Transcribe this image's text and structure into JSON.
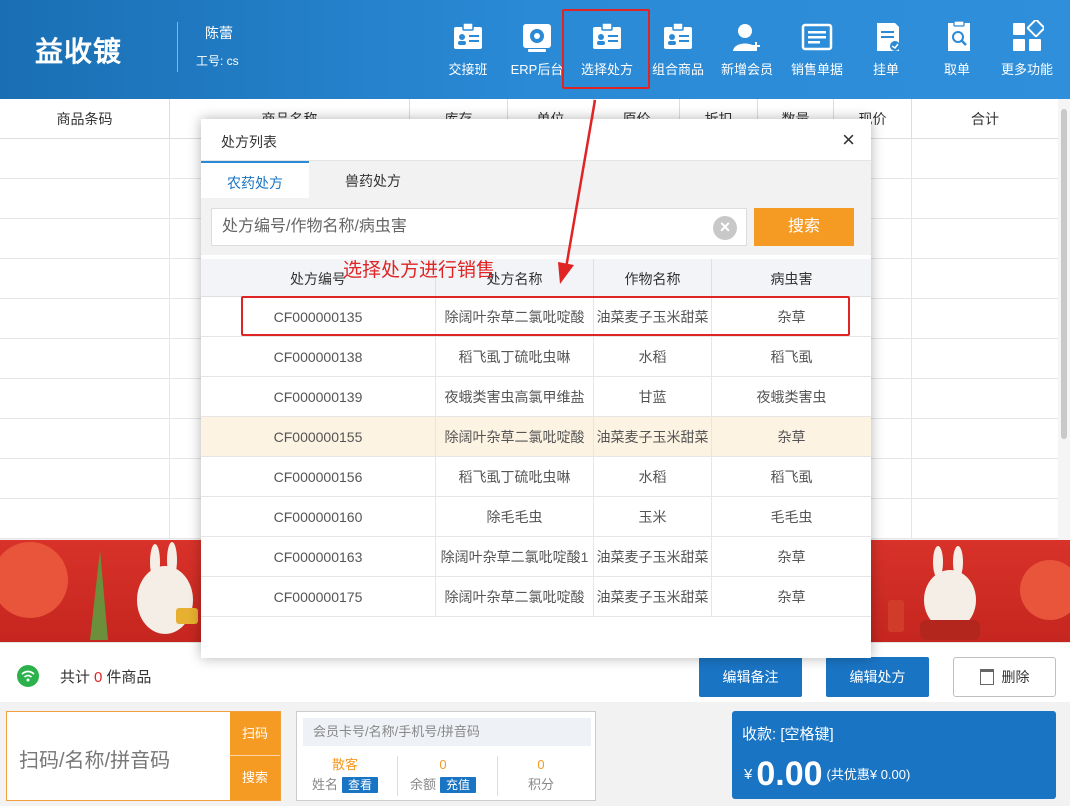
{
  "header": {
    "logo": "益收镀",
    "user_name": "陈蕾",
    "user_id_label": "工号: cs",
    "toolbar": [
      {
        "label": "交接班",
        "icon": "handover-icon"
      },
      {
        "label": "ERP后台",
        "icon": "erp-settings-icon"
      },
      {
        "label": "选择处方",
        "icon": "prescription-icon"
      },
      {
        "label": "组合商品",
        "icon": "combo-goods-icon"
      },
      {
        "label": "新增会员",
        "icon": "add-member-icon"
      },
      {
        "label": "销售单据",
        "icon": "sales-receipt-icon"
      },
      {
        "label": "挂单",
        "icon": "hold-order-icon"
      },
      {
        "label": "取单",
        "icon": "retrieve-order-icon"
      },
      {
        "label": "更多功能",
        "icon": "more-functions-icon"
      }
    ]
  },
  "grid": {
    "columns": [
      "商品条码",
      "商品名称",
      "库存",
      "单位",
      "原价",
      "折扣",
      "数量",
      "现价",
      "合计"
    ]
  },
  "bottom": {
    "count_prefix": "共计",
    "count_value": "0",
    "count_suffix": "件商品",
    "edit_note": "编辑备注",
    "edit_prescription": "编辑处方",
    "delete": "删除"
  },
  "scan": {
    "placeholder": "扫码/名称/拼音码",
    "scan_btn": "扫码",
    "search_btn": "搜索"
  },
  "member": {
    "placeholder": "会员卡号/名称/手机号/拼音码",
    "name_value": "散客",
    "name_label": "姓名",
    "name_action": "查看",
    "balance_value": "0",
    "balance_label": "余额",
    "balance_action": "充值",
    "points_value": "0",
    "points_label": "积分"
  },
  "pay": {
    "label": "收款: [空格键]",
    "currency": "¥",
    "amount": "0.00",
    "discount": "(共优惠¥ 0.00)"
  },
  "modal": {
    "title": "处方列表",
    "tabs": [
      "农药处方",
      "兽药处方"
    ],
    "search_placeholder": "处方编号/作物名称/病虫害",
    "search_button": "搜索",
    "columns": [
      "处方编号",
      "处方名称",
      "作物名称",
      "病虫害"
    ],
    "rows": [
      [
        "CF000000135",
        "除阔叶杂草二氯吡啶酸",
        "油菜麦子玉米甜菜",
        "杂草"
      ],
      [
        "CF000000138",
        "稻飞虱丁硫吡虫啉",
        "水稻",
        "稻飞虱"
      ],
      [
        "CF000000139",
        "夜蛾类害虫高氯甲维盐",
        "甘蓝",
        "夜蛾类害虫"
      ],
      [
        "CF000000155",
        "除阔叶杂草二氯吡啶酸",
        "油菜麦子玉米甜菜",
        "杂草"
      ],
      [
        "CF000000156",
        "稻飞虱丁硫吡虫啉",
        "水稻",
        "稻飞虱"
      ],
      [
        "CF000000160",
        "除毛毛虫",
        "玉米",
        "毛毛虫"
      ],
      [
        "CF000000163",
        "除阔叶杂草二氯吡啶酸1",
        "油菜麦子玉米甜菜",
        "杂草"
      ],
      [
        "CF000000175",
        "除阔叶杂草二氯吡啶酸",
        "油菜麦子玉米甜菜",
        "杂草"
      ]
    ]
  },
  "annotation": "选择处方进行销售",
  "colors": {
    "primary": "#1a74c4",
    "accent": "#f59a23",
    "annotation": "#e02424"
  }
}
